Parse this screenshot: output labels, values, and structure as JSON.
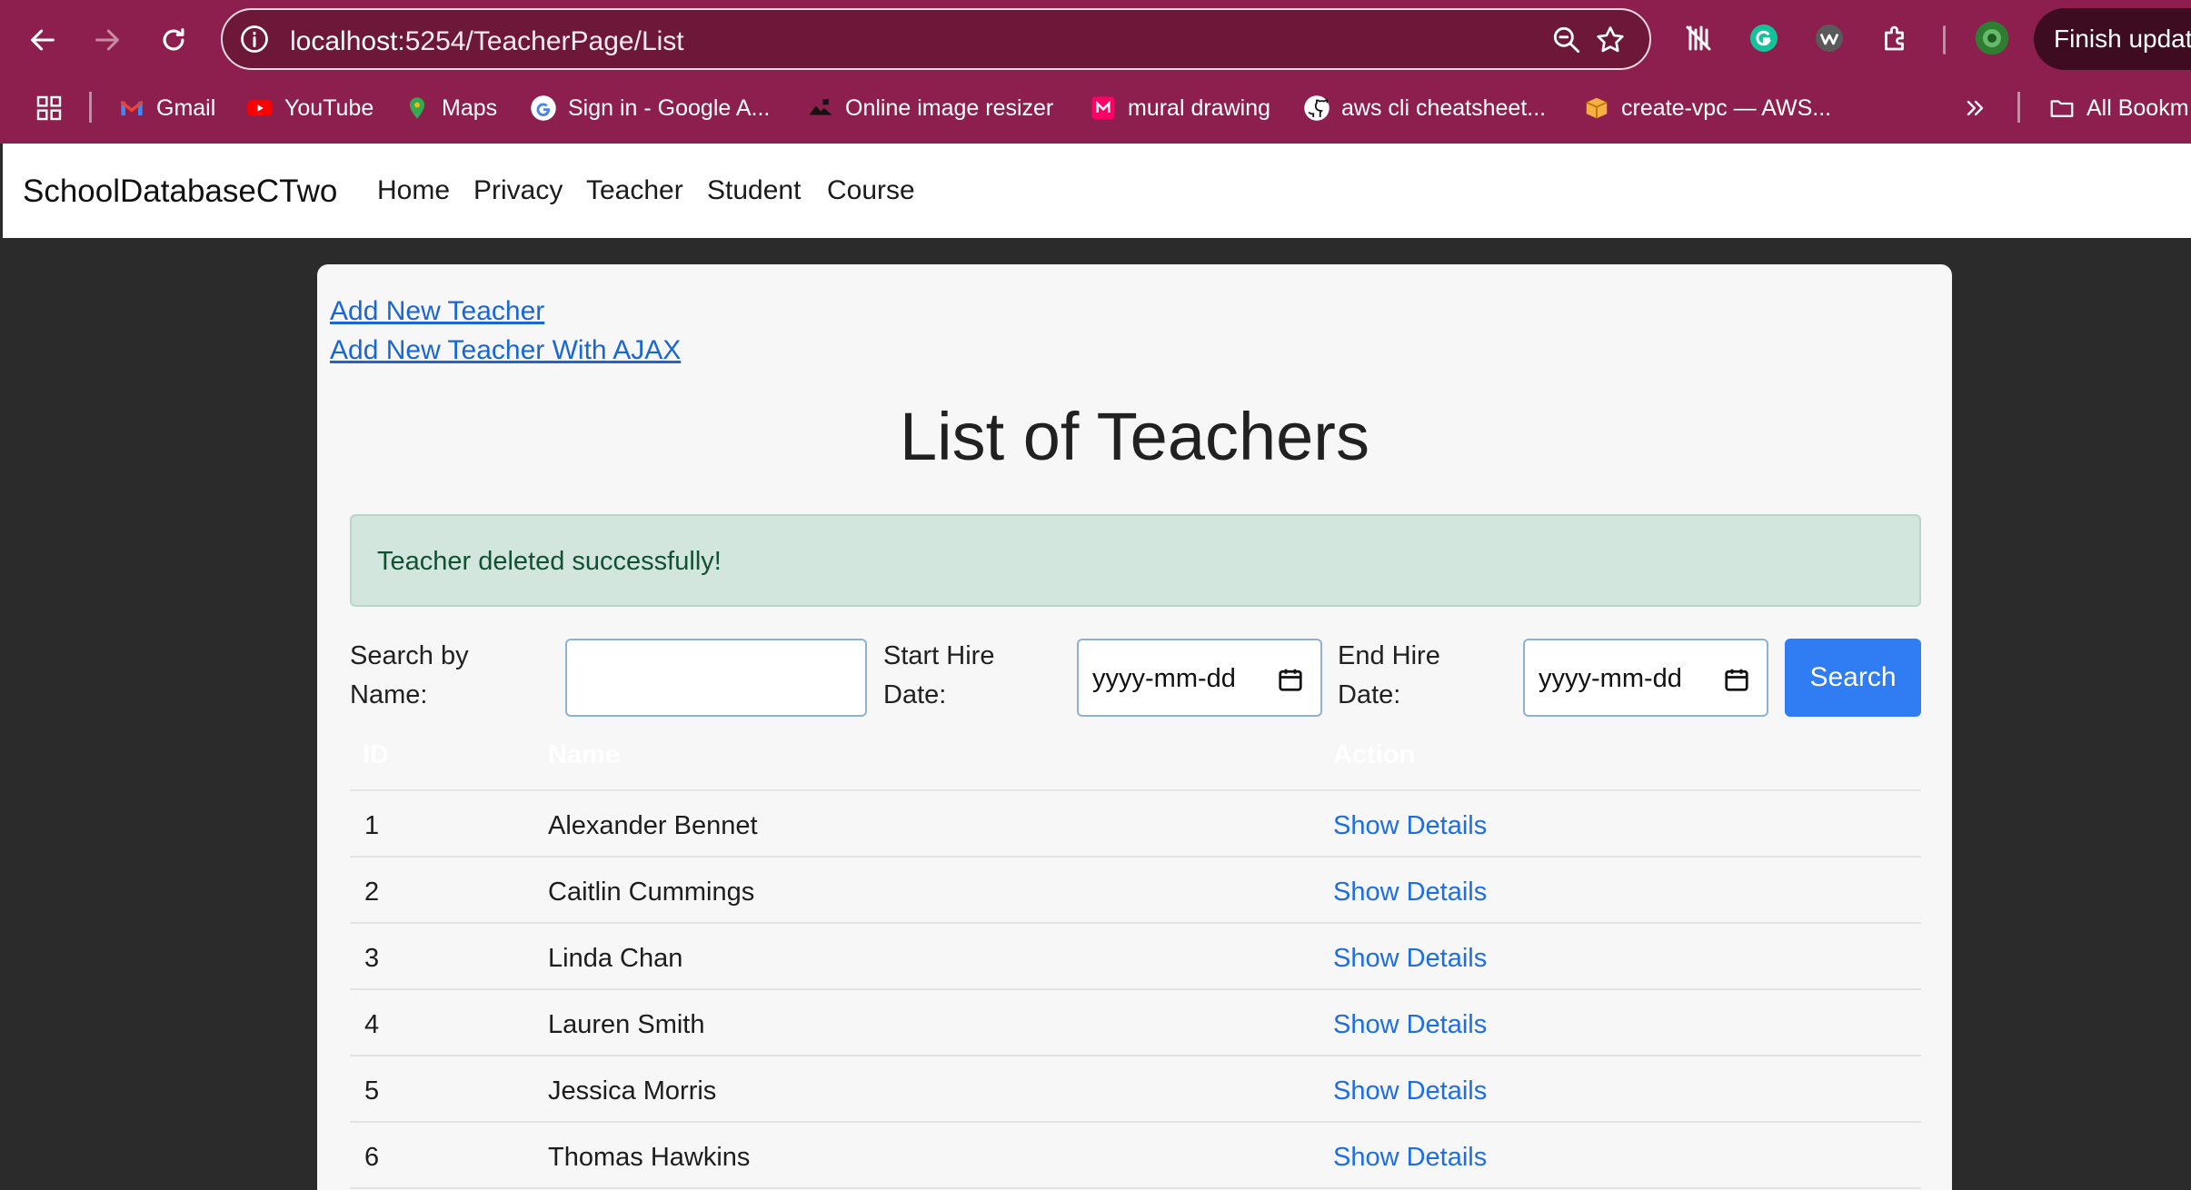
{
  "browser": {
    "url_host": "localhost",
    "url_rest": ":5254/TeacherPage/List",
    "finish_update_label": "Finish updat",
    "bookmarks": [
      {
        "label": "Gmail",
        "icon": "gmail-icon"
      },
      {
        "label": "YouTube",
        "icon": "youtube-icon"
      },
      {
        "label": "Maps",
        "icon": "maps-icon"
      },
      {
        "label": "Sign in - Google A...",
        "icon": "google-icon"
      },
      {
        "label": "Online image resizer",
        "icon": "resizer-icon"
      },
      {
        "label": "mural drawing",
        "icon": "mural-icon"
      },
      {
        "label": "aws cli cheatsheet...",
        "icon": "github-icon"
      },
      {
        "label": "create-vpc — AWS...",
        "icon": "aws-box-icon"
      }
    ],
    "all_bookmarks_label": "All Bookm"
  },
  "navbar": {
    "brand": "SchoolDatabaseCTwo",
    "links": [
      "Home",
      "Privacy",
      "Teacher",
      "Student",
      "Course"
    ]
  },
  "content": {
    "add_teacher_link": "Add New Teacher",
    "add_teacher_ajax_link": "Add New Teacher With AJAX",
    "title": "List of Teachers",
    "alert": "Teacher deleted successfully!",
    "search": {
      "name_label": "Search by Name:",
      "name_value": "",
      "start_label": "Start Hire Date:",
      "start_placeholder": "yyyy-mm-dd",
      "end_label": "End Hire Date:",
      "end_placeholder": "yyyy-mm-dd",
      "button": "Search"
    },
    "table": {
      "headers": [
        "ID",
        "Name",
        "Action"
      ],
      "rows": [
        {
          "id": "1",
          "name": "Alexander Bennet",
          "action": "Show Details"
        },
        {
          "id": "2",
          "name": "Caitlin Cummings",
          "action": "Show Details"
        },
        {
          "id": "3",
          "name": "Linda Chan",
          "action": "Show Details"
        },
        {
          "id": "4",
          "name": "Lauren Smith",
          "action": "Show Details"
        },
        {
          "id": "5",
          "name": "Jessica Morris",
          "action": "Show Details"
        },
        {
          "id": "6",
          "name": "Thomas Hawkins",
          "action": "Show Details"
        }
      ]
    }
  },
  "colors": {
    "chrome": "#8c1f4d",
    "link": "#1a66d2",
    "primary_button": "#2f7cf3",
    "alert_bg": "#d3e6de",
    "alert_text": "#0f5132"
  }
}
